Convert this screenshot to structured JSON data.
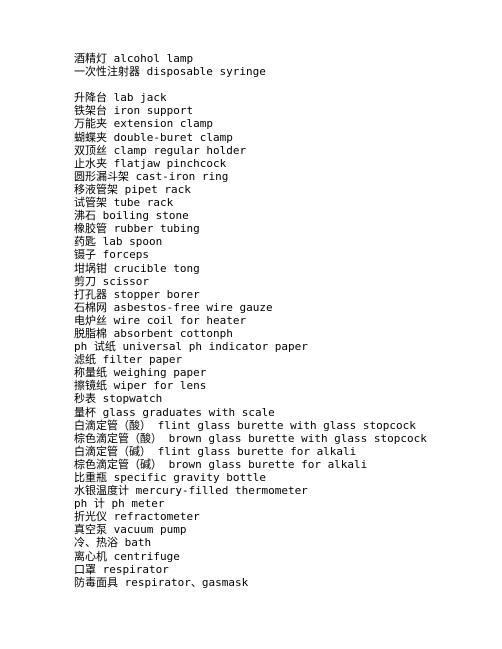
{
  "document": {
    "type": "plain-text-glossary",
    "language": "zh-CN / en",
    "lines": [
      "酒精灯 alcohol lamp",
      "一次性注射器 disposable syringe",
      "",
      "升降台 lab jack",
      "铁架台 iron support",
      "万能夹 extension clamp",
      "蝴蝶夹 double-buret clamp",
      "双顶丝 clamp regular holder",
      "止水夹 flatjaw pinchcock",
      "圆形漏斗架 cast-iron ring",
      "移液管架 pipet rack",
      "试管架 tube rack",
      "沸石 boiling stone",
      "橡胶管 rubber tubing",
      "药匙 lab spoon",
      "镊子 forceps",
      "坩埚钳 crucible tong",
      "剪刀 scissor",
      "打孔器 stopper borer",
      "石棉网 asbestos-free wire gauze",
      "电炉丝 wire coil for heater",
      "脱脂棉 absorbent cottonph",
      "ph 试纸 universal ph indicator paper",
      "滤纸 filter paper",
      "称量纸 weighing paper",
      "擦镜纸 wiper for lens",
      "秒表 stopwatch",
      "量杯 glass graduates with scale",
      "白滴定管（酸） flint glass burette with glass stopcock",
      "棕色滴定管（酸） brown glass burette with glass stopcock",
      "白滴定管（碱） flint glass burette for alkali",
      "棕色滴定管（碱） brown glass burette for alkali",
      "比重瓶 specific gravity bottle",
      "水银温度计 mercury-filled thermometer",
      "ph 计 ph meter",
      "折光仪 refractometer",
      "真空泵 vacuum pump",
      "冷、热浴 bath",
      "离心机 centrifuge",
      "口罩 respirator",
      "防毒面具 respirator、gasmask"
    ]
  }
}
